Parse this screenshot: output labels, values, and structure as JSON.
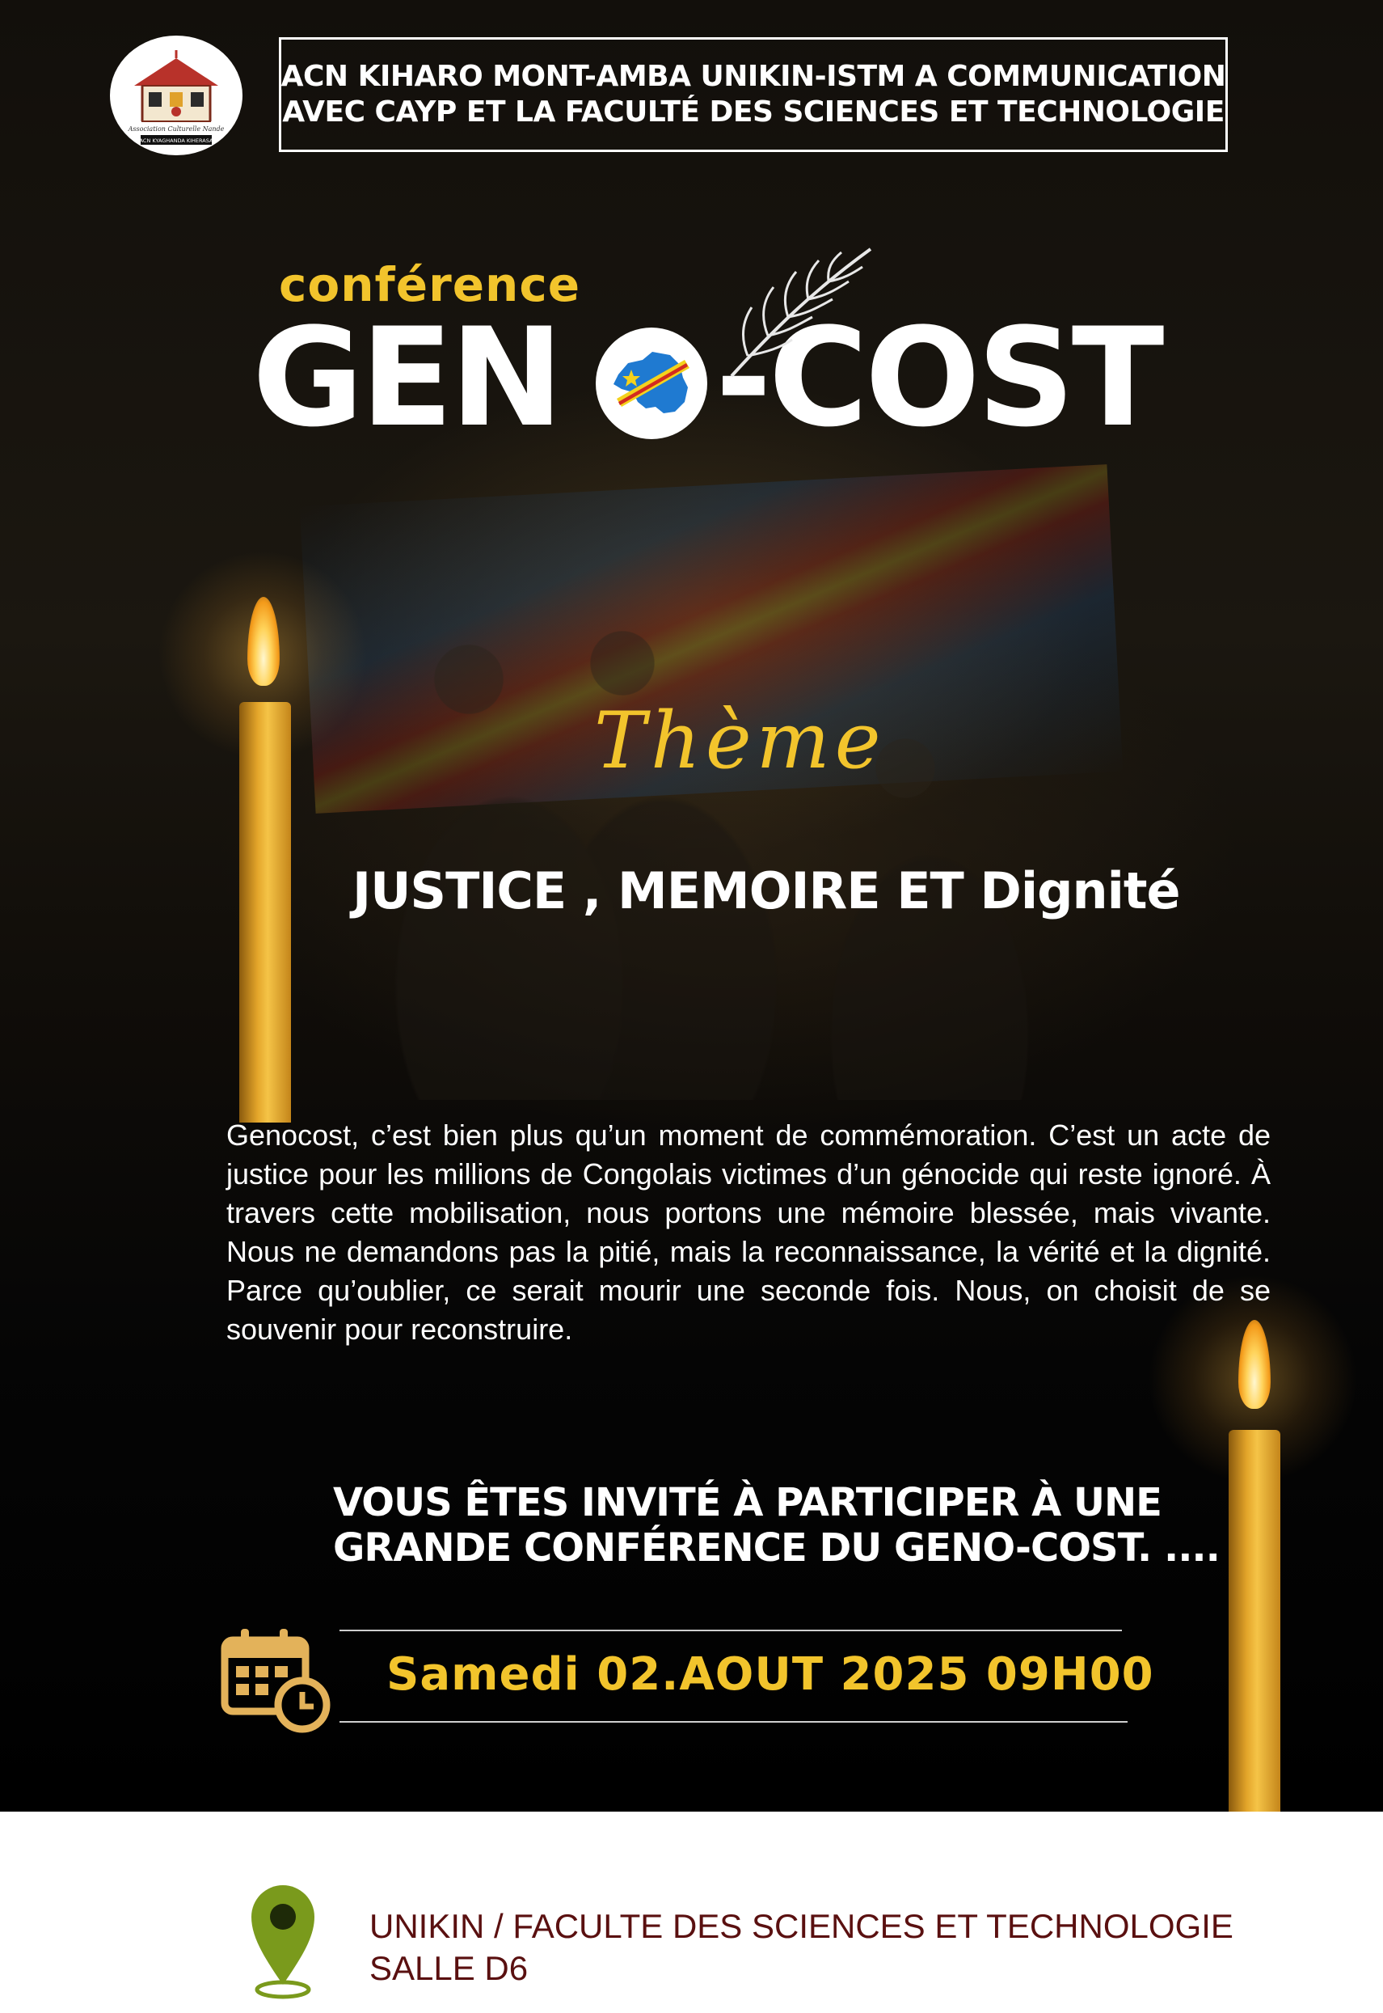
{
  "header": {
    "logo_text_line1": "Association Culturelle Nande",
    "logo_text_line2": "ACN KYAGHANDA KIHERASA",
    "org_line1": "ACN KIHARO MONT-AMBA UNIKIN-ISTM A COMMUNICATION",
    "org_line2": "AVEC CAYP ET LA FACULTÉ DES SCIENCES ET TECHNOLOGIE"
  },
  "event": {
    "label": "conférence",
    "title_part1": "GEN",
    "title_part2": "-COST"
  },
  "theme": {
    "label": "Thème",
    "title": "JUSTICE , MEMOIRE ET Dignité"
  },
  "description": "Genocost, c’est bien plus qu’un moment de commémoration. C’est un acte de justice pour les millions de Congolais victimes d’un génocide qui reste ignoré. À travers cette mobilisation, nous portons une mémoire blessée, mais vivante. Nous ne demandons pas la pitié, mais la reconnaissance, la vérité et la dignité. Parce qu’oublier, ce serait mourir une seconde fois. Nous, on choisit de se souvenir pour reconstruire.",
  "invitation": {
    "line1": "VOUS ÊTES INVITÉ À PARTICIPER À UNE",
    "line2": "GRANDE CONFÉRENCE DU GENO-COST. ...."
  },
  "schedule": {
    "icon": "calendar-clock-icon",
    "datetime": "Samedi 02.AOUT 2025  09H00"
  },
  "location": {
    "icon": "location-pin-icon",
    "line1": "UNIKIN / FACULTE DES SCIENCES ET TECHNOLOGIE",
    "line2": "SALLE D6"
  },
  "colors": {
    "accent_gold": "#f2c42c",
    "location_text": "#5a1010",
    "pin_green": "#7a9a1c"
  }
}
